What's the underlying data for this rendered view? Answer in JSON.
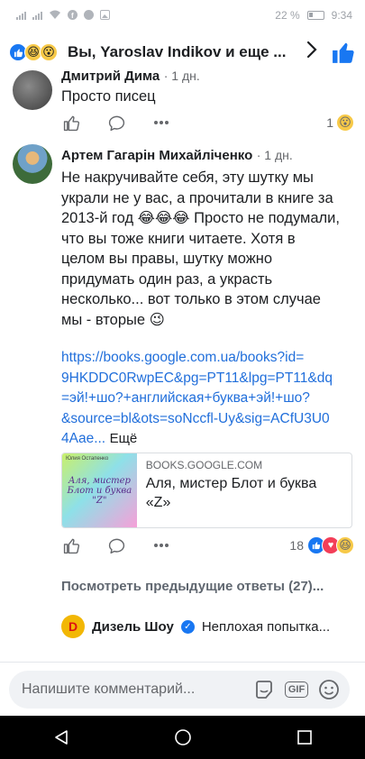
{
  "status_bar": {
    "battery": "22 %",
    "time": "9:34"
  },
  "header": {
    "title": "Вы, Yaroslav Indikov и еще ...",
    "reactions": [
      "like",
      "laugh",
      "wow"
    ]
  },
  "comment_prev": {
    "author": "Дмитрий Дима",
    "time": "1 дн.",
    "text": "Просто писец",
    "reaction_count": "1",
    "reaction": "wow"
  },
  "comment_main": {
    "author": "Артем Гагарін Михайліченко",
    "time": "1 дн.",
    "text_line1": "Не накручивайте себя, эту шутку мы",
    "text_line2": "украли не у вас, а прочитали в книге за",
    "text_line3": "2013-й год 😂😂😂 Просто не подумали,",
    "text_line4": "что вы тоже книги читаете. Хотя в",
    "text_line5": "целом вы правы, шутку можно",
    "text_line6": "придумать один раз, а украсть",
    "text_line7": "несколько... вот только в этом случае",
    "text_line8": "мы - вторые 😉",
    "link_line1": "https://books.google.com.ua/books?id=",
    "link_line2": "9HKDDC0RwpEC&pg=PT11&lpg=PT11&dq",
    "link_line3": "=эй!+шо?+английская+буква+эй!+шо?",
    "link_line4": "&source=bl&ots=soNccfl-Uy&sig=ACfU3U0",
    "link_line5": "4Aae...",
    "more_label": "Ещё",
    "card_domain": "BOOKS.GOOGLE.COM",
    "card_title": "Аля, мистер Блот и буква «Z»",
    "card_thumb_author": "Юлия Остапенко",
    "card_thumb_text": "Аля, мистер Блот и буква \"Z\"",
    "reaction_count": "18",
    "reactions": [
      "like",
      "love",
      "laugh"
    ]
  },
  "previous_replies_label": "Посмотреть предыдущие ответы (27)...",
  "reply": {
    "author": "Дизель Шоу",
    "text": "Неплохая попытка...",
    "avatar_letter": "D"
  },
  "composer": {
    "placeholder": "Напишите комментарий...",
    "gif_label": "GIF"
  }
}
